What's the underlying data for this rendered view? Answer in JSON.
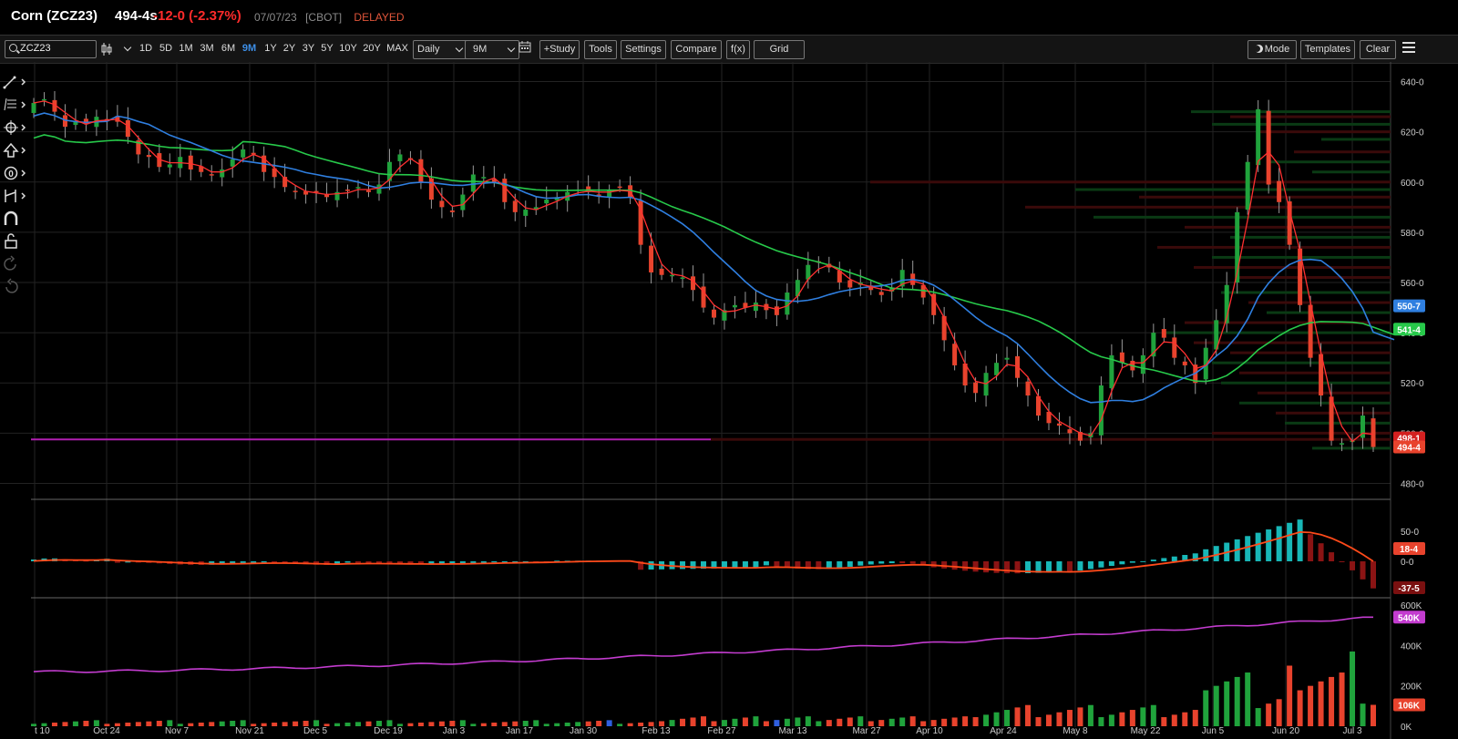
{
  "header": {
    "symbol": "Corn (ZCZ23)",
    "price": "494-4s",
    "change": "-12-0 (-2.37%)",
    "date": "07/07/23",
    "exchange": "[CBOT]",
    "status": "DELAYED"
  },
  "toolbar": {
    "search_value": "ZCZ23",
    "ranges": [
      "1D",
      "5D",
      "1M",
      "3M",
      "6M",
      "9M",
      "1Y",
      "2Y",
      "3Y",
      "5Y",
      "10Y",
      "20Y",
      "MAX"
    ],
    "active_range": "9M",
    "interval": "Daily",
    "period": "9M",
    "study_label": "+Study",
    "tools_label": "Tools",
    "settings_label": "Settings",
    "compare_label": "Compare",
    "fx_label": "f(x)",
    "grid_label": "Grid",
    "mode_label": "Mode",
    "templates_label": "Templates",
    "clear_label": "Clear"
  },
  "sidebar_icons": [
    "draw-line-icon",
    "fibonacci-icon",
    "crosshair-icon",
    "arrow-up-icon",
    "zero-icon",
    "measure-icon",
    "magnet-icon",
    "lock-icon",
    "undo-icon",
    "redo-icon"
  ],
  "colors": {
    "up": "#20a33c",
    "down": "#e8432d",
    "ma_fast": "#2f7fe0",
    "ma_slow": "#27c94a",
    "ma_short": "#ff3030",
    "hline": "#b01fb0",
    "hist_up": "#18b7b7",
    "hist_down": "#8b1414",
    "signal": "#ff4a1a",
    "oi": "#c33ccf"
  },
  "chart_data": [
    {
      "type": "candlestick",
      "x_ticks": [
        "t 10",
        "Oct 24",
        "Nov 7",
        "Nov 21",
        "Dec 5",
        "Dec 19",
        "Jan 3",
        "Jan 17",
        "Jan 30",
        "Feb 13",
        "Feb 27",
        "Mar 13",
        "Mar 27",
        "Apr 10",
        "Apr 24",
        "May 8",
        "May 22",
        "Jun 5",
        "Jun 20",
        "Jul 3"
      ],
      "y_ticks": [
        "640-0",
        "620-0",
        "600-0",
        "580-0",
        "560-0",
        "540-0",
        "520-0",
        "500-0",
        "480-0"
      ],
      "ylim": [
        474,
        646
      ],
      "closes": [
        631.5,
        633,
        628,
        622,
        624,
        623,
        626,
        625,
        624,
        618,
        611,
        610,
        606,
        607,
        610,
        605,
        604,
        603,
        605,
        609,
        613,
        611,
        604,
        602,
        598,
        596,
        595,
        596,
        594,
        596,
        597,
        598,
        596,
        599,
        608,
        611,
        609,
        600,
        593,
        590,
        588,
        595,
        603,
        602,
        600,
        592,
        588,
        589,
        590,
        593,
        594,
        596,
        597,
        596,
        595,
        597,
        598,
        594,
        575,
        564,
        563,
        563,
        562,
        557,
        550,
        546,
        549,
        551,
        550,
        552,
        549,
        547,
        556,
        561,
        567,
        568,
        566,
        560,
        558,
        560,
        557,
        555,
        558,
        565,
        559,
        554,
        547,
        537,
        527,
        519,
        516,
        524,
        528,
        530,
        522,
        515,
        507,
        504,
        503,
        500,
        497,
        500,
        519,
        531,
        528,
        525,
        531,
        540,
        538,
        530,
        527,
        520,
        534,
        545,
        559,
        588,
        608,
        629,
        599,
        592,
        575,
        551,
        530,
        515,
        497,
        496,
        497,
        507,
        494.5
      ],
      "last_price_label": "494-4",
      "last_price_label2": "498-1",
      "ma_labels": {
        "fast": "550-7",
        "slow": "541-4"
      },
      "hline_value": 497.5
    },
    {
      "type": "histogram",
      "name": "oscillator",
      "y_ticks": [
        "50-0",
        "0-0"
      ],
      "labels": [
        "18-4",
        "-37-5"
      ]
    },
    {
      "type": "bar",
      "name": "volume",
      "y_ticks": [
        "600K",
        "400K",
        "200K",
        "0K"
      ],
      "labels": [
        "540K",
        "106K"
      ],
      "open_interest": {
        "start": 270000,
        "end": 540000
      }
    }
  ]
}
